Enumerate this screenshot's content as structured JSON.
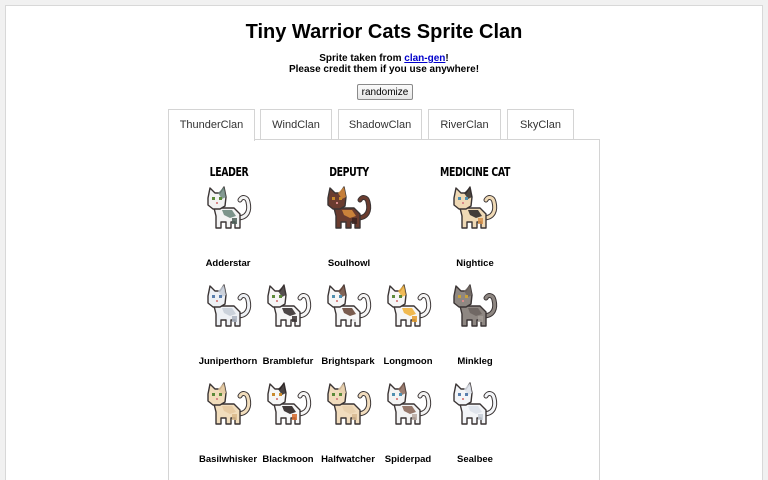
{
  "title": "Tiny Warrior Cats Sprite Clan",
  "credit": {
    "prefix": "Sprite taken from ",
    "link": "clan-gen",
    "suffix": "!",
    "line2": "Please credit them if you use anywhere!"
  },
  "randomize_label": "randomize",
  "tabs": [
    "ThunderClan",
    "WindClan",
    "ShadowClan",
    "RiverClan",
    "SkyClan"
  ],
  "active_tab": "ThunderClan",
  "ranks": {
    "leader": "LEADER",
    "deputy": "DEPUTY",
    "medicine": "MEDICINE CAT"
  },
  "cats": {
    "leader": {
      "name": "Adderstar",
      "body": "#f3f3f3",
      "patch": "#6f8a80",
      "patch2": "#4d5f58",
      "eye": "#5b8a3a"
    },
    "deputy": {
      "name": "Soulhowl",
      "body": "#6a3c2f",
      "patch": "#d58a3c",
      "patch2": "#3b2320",
      "eye": "#c98a2c"
    },
    "medicine": {
      "name": "Nightice",
      "body": "#efd9b5",
      "patch": "#2f2a2a",
      "patch2": "#d7904a",
      "eye": "#4f8fb0"
    },
    "row2": [
      {
        "name": "Juniperthorn",
        "body": "#eef1f5",
        "patch": "#c7ced8",
        "patch2": "#a9b2be",
        "eye": "#5a7fae"
      },
      {
        "name": "Bramblefur",
        "body": "#f6f6f6",
        "patch": "#3a3333",
        "patch2": "#3a3333",
        "eye": "#5b8a3a"
      },
      {
        "name": "Brightspark",
        "body": "#f6f6f6",
        "patch": "#6b4a3c",
        "patch2": "#f6f6f6",
        "eye": "#4f8fb0"
      },
      {
        "name": "Longmoon",
        "body": "#f6f6f6",
        "patch": "#f0b23e",
        "patch2": "#e39a2a",
        "eye": "#5b8a3a"
      }
    ],
    "row2_med": {
      "name": "Minkleg",
      "body": "#8e8782",
      "patch": "#6d6560",
      "patch2": "#a39c96",
      "eye": "#c9a23a"
    },
    "row3": [
      {
        "name": "Basilwhisker",
        "body": "#f1ddbc",
        "patch": "#e5c9a0",
        "patch2": "#d9b98a",
        "eye": "#5b8a3a"
      },
      {
        "name": "Blackmoon",
        "body": "#f6f6f6",
        "patch": "#2b2424",
        "patch2": "#d5692c",
        "eye": "#c98a2c"
      },
      {
        "name": "Halfwatcher",
        "body": "#f1dcbd",
        "patch": "#e8cfac",
        "patch2": "#d7b890",
        "eye": "#5b8a3a"
      },
      {
        "name": "Spiderpad",
        "body": "#f3f3f3",
        "patch": "#8c6a5c",
        "patch2": "#b8a8a0",
        "eye": "#4f8fb0"
      }
    ],
    "row3_med": {
      "name": "Sealbee",
      "body": "#f3f5f8",
      "patch": "#dde2ea",
      "patch2": "#c5ccd6",
      "eye": "#5a7fae"
    }
  }
}
